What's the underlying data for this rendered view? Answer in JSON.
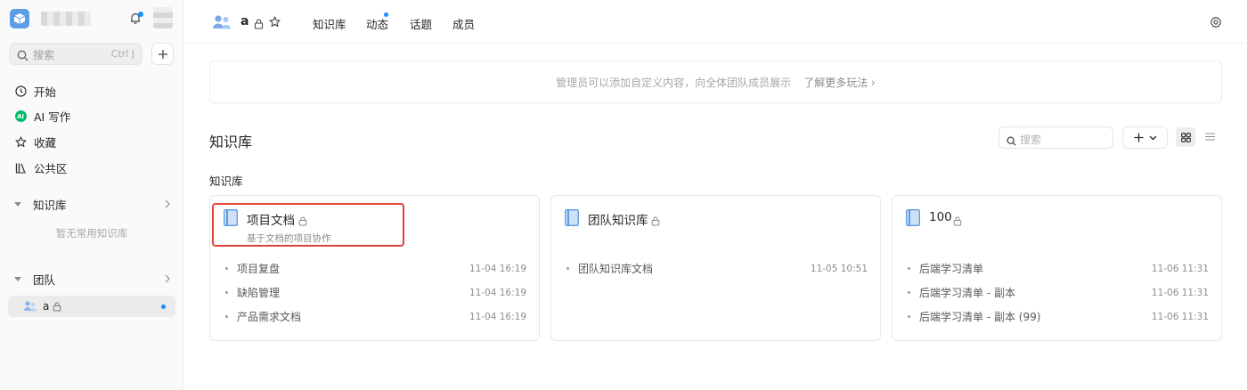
{
  "sidebar": {
    "search": {
      "placeholder": "搜索",
      "shortcut": "Ctrl J"
    },
    "nav": [
      {
        "label": "开始",
        "icon": "clock-icon"
      },
      {
        "label": "AI 写作",
        "icon": "ai-icon",
        "badge": "AI"
      },
      {
        "label": "收藏",
        "icon": "star-icon"
      },
      {
        "label": "公共区",
        "icon": "library-icon"
      }
    ],
    "knowledge_section": {
      "label": "知识库",
      "empty_text": "暂无常用知识库"
    },
    "team_section": {
      "label": "团队",
      "items": [
        {
          "label": "a"
        }
      ]
    }
  },
  "header": {
    "team_name": "a",
    "tabs": [
      "知识库",
      "动态",
      "话题",
      "成员"
    ]
  },
  "banner": {
    "text": "管理员可以添加自定义内容，向全体团队成员展示",
    "link": "了解更多玩法 ›"
  },
  "main": {
    "title": "知识库",
    "search_placeholder": "搜索",
    "subtitle": "知识库",
    "cards": [
      {
        "title": "项目文档",
        "description": "基于文档的项目协作",
        "docs": [
          {
            "name": "项目复盘",
            "time": "11-04 16:19"
          },
          {
            "name": "缺陷管理",
            "time": "11-04 16:19"
          },
          {
            "name": "产品需求文档",
            "time": "11-04 16:19"
          }
        ]
      },
      {
        "title": "团队知识库",
        "description": "",
        "docs": [
          {
            "name": "团队知识库文档",
            "time": "11-05 10:51"
          }
        ]
      },
      {
        "title": "100",
        "description": "",
        "docs": [
          {
            "name": "后端学习清单",
            "time": "11-06 11:31"
          },
          {
            "name": "后端学习清单 - 副本",
            "time": "11-06 11:31"
          },
          {
            "name": "后端学习清单 - 副本 (99)",
            "time": "11-06 11:31"
          }
        ]
      }
    ]
  },
  "colors": {
    "accent": "#1890ff",
    "highlight": "#e0433a",
    "book": "#5b9be0",
    "ai_badge": "#00b96b"
  }
}
